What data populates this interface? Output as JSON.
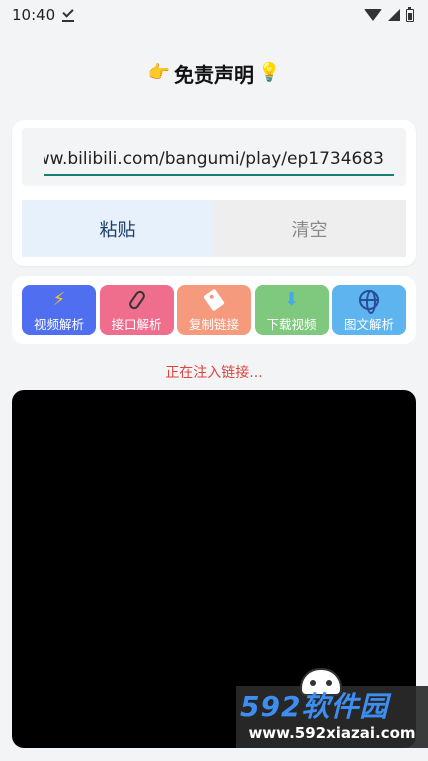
{
  "status_bar": {
    "time": "10:40",
    "icons": [
      "download-done-icon",
      "wifi-icon",
      "signal-icon",
      "battery-icon"
    ]
  },
  "header": {
    "title": "免责声明",
    "left_emoji": "👉",
    "right_emoji": "💡"
  },
  "url_input": {
    "value": "ww.bilibili.com/bangumi/play/ep1734683"
  },
  "actions": {
    "paste_label": "粘贴",
    "clear_label": "清空"
  },
  "tools": [
    {
      "label": "视频解析",
      "icon": "lightning-icon",
      "color": "#4f6ff0"
    },
    {
      "label": "接口解析",
      "icon": "paperclip-icon",
      "color": "#ef6e8e"
    },
    {
      "label": "复制链接",
      "icon": "tag-icon",
      "color": "#f59a7d"
    },
    {
      "label": "下载视频",
      "icon": "download-arrow-icon",
      "color": "#7ec97e"
    },
    {
      "label": "图文解析",
      "icon": "globe-icon",
      "color": "#5db4ee"
    }
  ],
  "status_message": "正在注入链接...",
  "watermark": {
    "logo_text": "592软件园",
    "url": "www.592xiazai.com"
  }
}
